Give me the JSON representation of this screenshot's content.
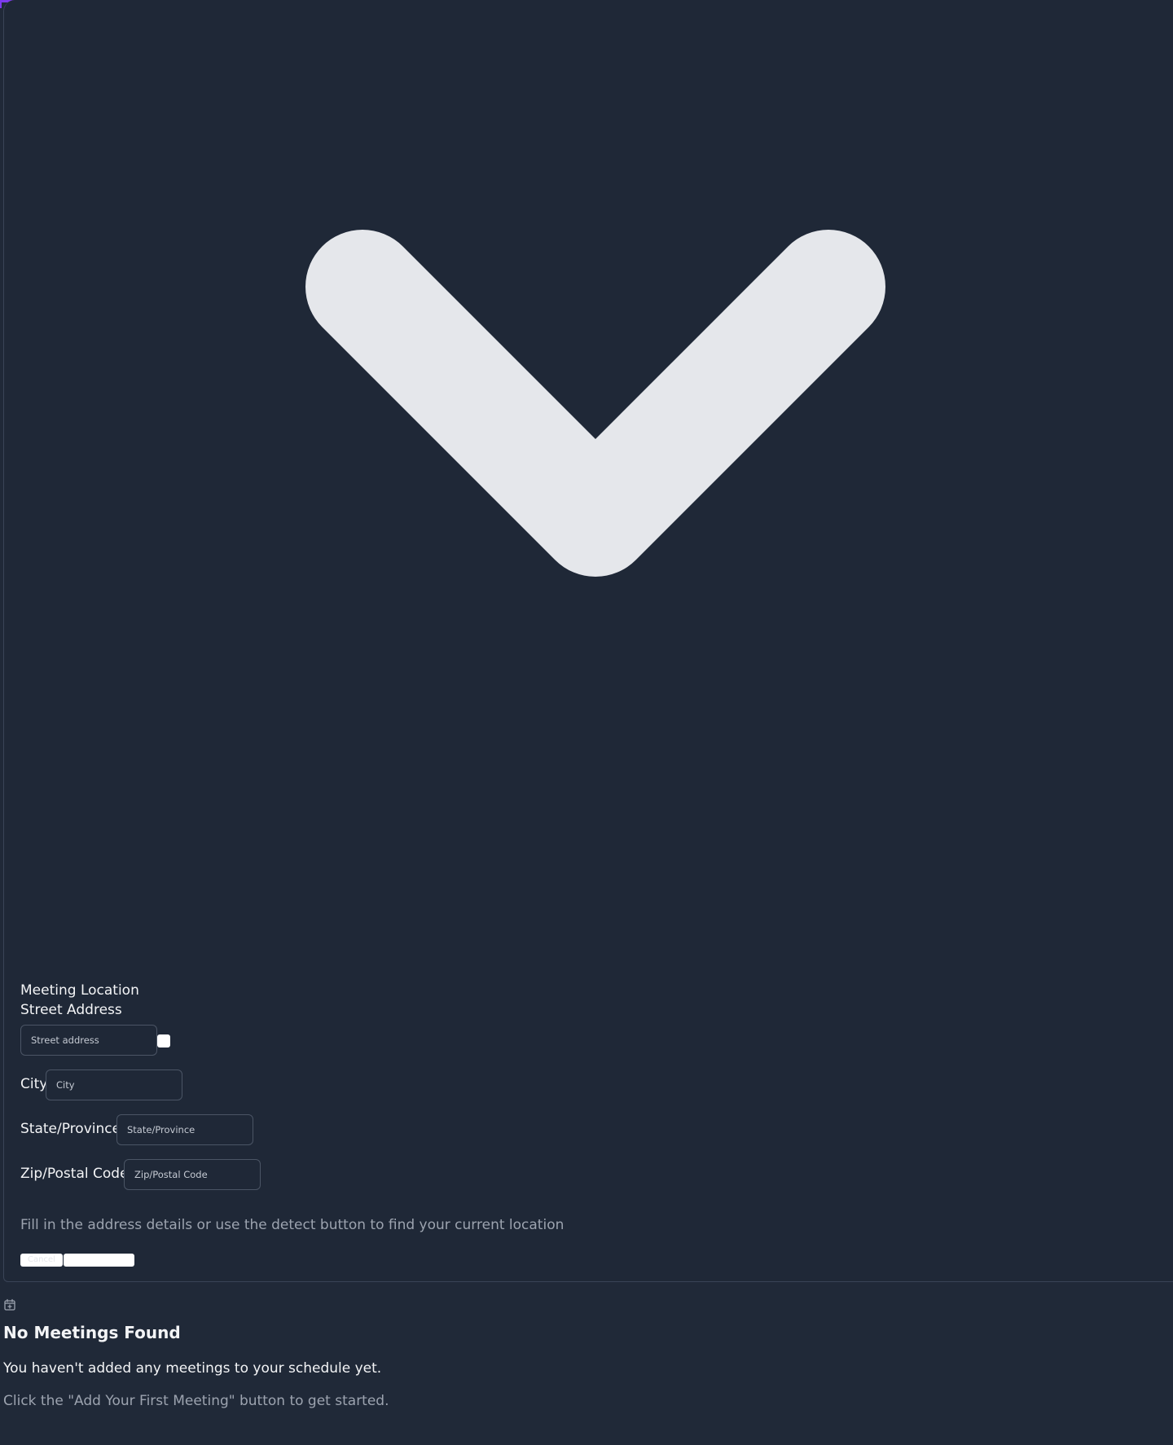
{
  "location_form": {
    "section_title": "Meeting Location",
    "street": {
      "label": "Street Address",
      "placeholder": "Street address",
      "value": ""
    },
    "detect_button_icon": "location-detect-icon",
    "city": {
      "label": "City",
      "placeholder": "City",
      "value": ""
    },
    "state": {
      "label": "State/Province",
      "placeholder": "State/Province",
      "value": ""
    },
    "zip": {
      "label": "Zip/Postal Code",
      "placeholder": "Zip/Postal Code",
      "value": ""
    },
    "help_text": "Fill in the address details or use the detect button to find your current location",
    "cancel_label": "Cancel",
    "save_label": ""
  },
  "dropdown_icon": "chevron-down-icon",
  "empty_state": {
    "icon": "calendar-plus-icon",
    "title": "No Meetings Found",
    "message": "You haven't added any meetings to your schedule yet.",
    "hint": "Click the \"Add Your First Meeting\" button to get started."
  },
  "colors": {
    "background": "#202938",
    "panel": "#1f2837",
    "border": "#3a4457",
    "text": "#f3f4f6",
    "muted_text": "#9ca3af",
    "icon": "#e5e7eb",
    "accent_gradient_start": "#7c3aed",
    "accent_gradient_end": "#db2777"
  }
}
